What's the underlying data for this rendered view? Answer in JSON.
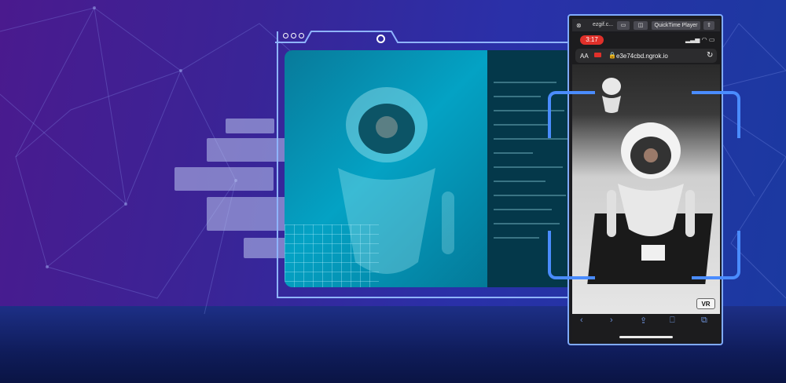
{
  "browser": {
    "tab_label": "ezgif.c...",
    "app_button": "QuickTime Player"
  },
  "phone": {
    "time": "3:17",
    "text_size_label": "AA",
    "url": "e3e74cbd.ngrok.io",
    "vr_button": "VR"
  },
  "colors": {
    "accent": "#4a8cff",
    "window_border": "#8fb4ff",
    "cyan_overlay": "#04a2c4"
  }
}
